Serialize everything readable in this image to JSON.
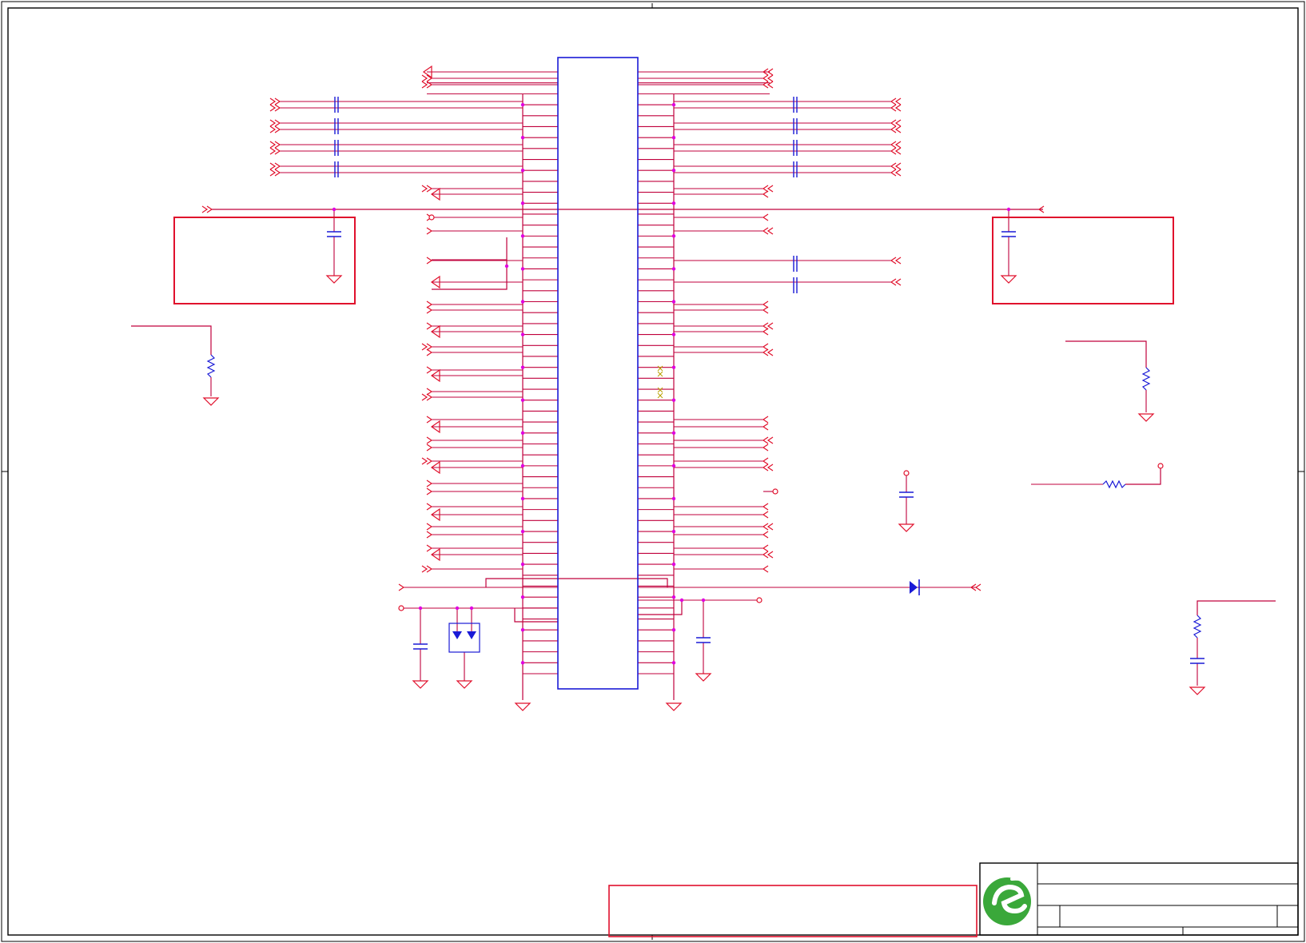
{
  "sheet": {
    "title_block": {
      "logo": "company-logo-icon"
    },
    "connector": {
      "left_pins": 56,
      "right_pins": 56
    },
    "colors": {
      "wire": "#c0003c",
      "part": "#1a1ad6",
      "power": "#e0102c",
      "junction": "#e000e0",
      "noconnect": "#b8a000",
      "frame": "#000000",
      "logo": "#3aa83a"
    }
  }
}
